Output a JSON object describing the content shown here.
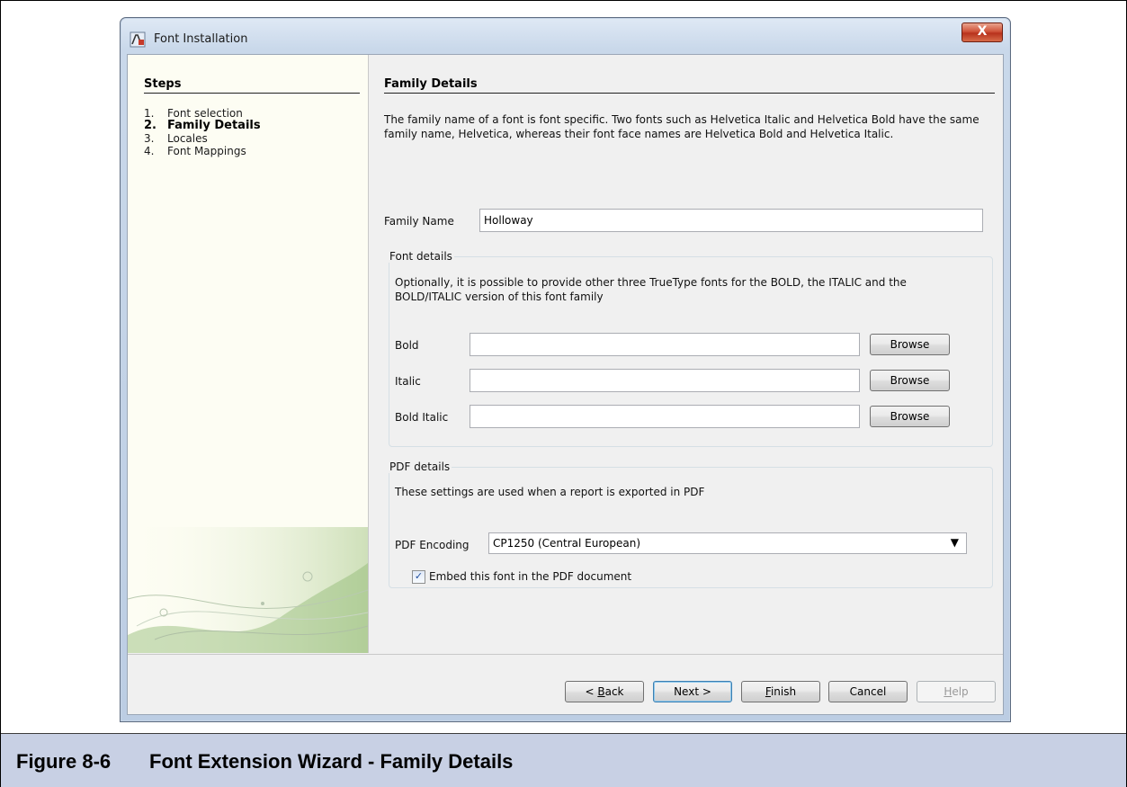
{
  "window": {
    "title": "Font Installation",
    "close_glyph": "X"
  },
  "steps": {
    "heading": "Steps",
    "items": [
      {
        "num": "1.",
        "label": "Font selection"
      },
      {
        "num": "2.",
        "label": "Family Details"
      },
      {
        "num": "3.",
        "label": "Locales"
      },
      {
        "num": "4.",
        "label": "Font Mappings"
      }
    ],
    "current_index": 1
  },
  "family_details": {
    "section_title": "Family Details",
    "description": "The family name of a font is font specific. Two fonts such as Helvetica Italic and Helvetica Bold have the same family name, Helvetica, whereas their font face names are Helvetica Bold and Helvetica Italic.",
    "family_name_label": "Family Name",
    "family_name_value": "Holloway"
  },
  "font_details": {
    "group_title": "Font details",
    "description": "Optionally, it is possible to provide other three TrueType fonts for the BOLD, the ITALIC and the BOLD/ITALIC version of this font family",
    "rows": [
      {
        "label": "Bold",
        "value": "",
        "button": "Browse"
      },
      {
        "label": "Italic",
        "value": "",
        "button": "Browse"
      },
      {
        "label": "Bold Italic",
        "value": "",
        "button": "Browse"
      }
    ]
  },
  "pdf_details": {
    "group_title": "PDF details",
    "description": "These settings are used when a report is exported in PDF",
    "encoding_label": "PDF Encoding",
    "encoding_value": "CP1250 (Central European)",
    "embed_label": "Embed this font in the PDF document",
    "embed_checked": true,
    "check_glyph": "✓",
    "arrow_glyph": "▼"
  },
  "buttons": {
    "back": {
      "pre": "< ",
      "mnemonic": "B",
      "rest": "ack"
    },
    "next": "Next >",
    "finish": {
      "mnemonic": "F",
      "rest": "inish"
    },
    "cancel": "Cancel",
    "help": {
      "mnemonic": "H",
      "rest": "elp"
    }
  },
  "caption": {
    "label": "Figure 8-6",
    "title": "Font Extension Wizard - Family Details"
  },
  "colors": {
    "caption_bg": "#c8d0e4",
    "close_button": "#c9462c",
    "steps_panel_bg": "#fdfdf3",
    "dialog_bg": "#f0f0f0"
  },
  "icons": [
    "app-icon",
    "close-icon",
    "dropdown-arrow-icon",
    "checkbox-check-icon",
    "decorative-swirl"
  ]
}
